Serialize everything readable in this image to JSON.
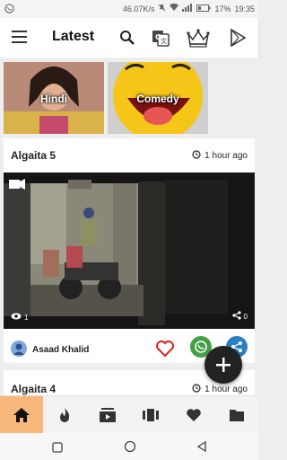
{
  "status_bar": {
    "left_icon": "whatsapp-notification-icon",
    "speed": "46.07K/s",
    "battery": "17%",
    "time": "19:35"
  },
  "app_bar": {
    "title": "Latest",
    "icons": [
      "menu-icon",
      "search-icon",
      "translate-icon",
      "crown-icon",
      "play-store-icon"
    ]
  },
  "categories": [
    {
      "label": "Hindi"
    },
    {
      "label": "Comedy"
    }
  ],
  "posts": [
    {
      "title": "Algaita 5",
      "time": "1 hour ago",
      "views": "1",
      "shares": "0",
      "author": "Asaad Khalid"
    },
    {
      "title": "Algaita 4",
      "time": "1 hour ago"
    }
  ],
  "bottom_nav": {
    "items": [
      "home-icon",
      "fire-icon",
      "video-library-icon",
      "carousel-icon",
      "favorite-icon",
      "folder-icon"
    ],
    "active_index": 0
  },
  "colors": {
    "accent": "#f7b77a",
    "heart": "#e02020",
    "whatsapp": "#43a047",
    "share": "#2a7fc0",
    "fab": "#222222"
  }
}
